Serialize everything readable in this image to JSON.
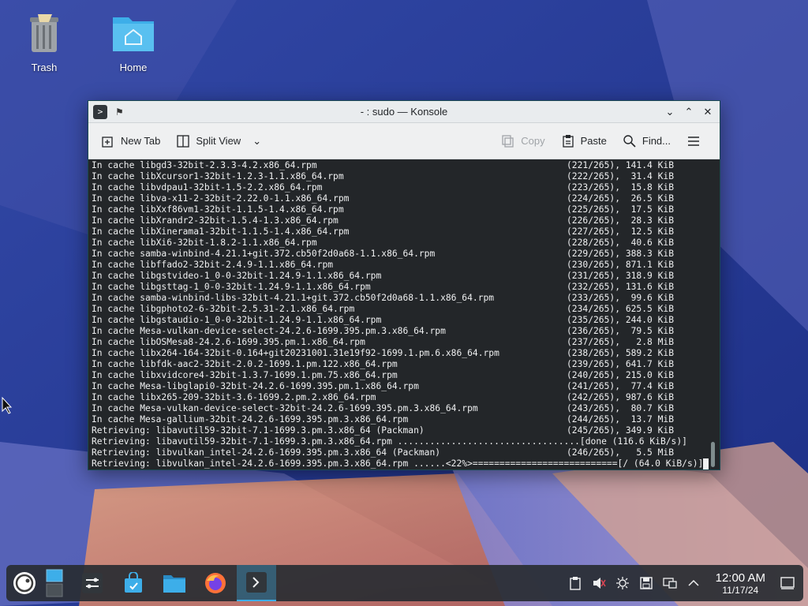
{
  "desktop": {
    "icons": [
      {
        "label": "Trash"
      },
      {
        "label": "Home"
      }
    ]
  },
  "window": {
    "title": "- : sudo — Konsole",
    "toolbar": {
      "new_tab": "New Tab",
      "split_view": "Split View",
      "copy": "Copy",
      "paste": "Paste",
      "find": "Find..."
    },
    "terminal_lines": [
      {
        "left": "In cache libgd3-32bit-2.3.3-4.2.x86_64.rpm",
        "right": "(221/265), 141.4 KiB"
      },
      {
        "left": "In cache libXcursor1-32bit-1.2.3-1.1.x86_64.rpm",
        "right": "(222/265),  31.4 KiB"
      },
      {
        "left": "In cache libvdpau1-32bit-1.5-2.2.x86_64.rpm",
        "right": "(223/265),  15.8 KiB"
      },
      {
        "left": "In cache libva-x11-2-32bit-2.22.0-1.1.x86_64.rpm",
        "right": "(224/265),  26.5 KiB"
      },
      {
        "left": "In cache libXxf86vm1-32bit-1.1.5-1.4.x86_64.rpm",
        "right": "(225/265),  17.5 KiB"
      },
      {
        "left": "In cache libXrandr2-32bit-1.5.4-1.3.x86_64.rpm",
        "right": "(226/265),  28.3 KiB"
      },
      {
        "left": "In cache libXinerama1-32bit-1.1.5-1.4.x86_64.rpm",
        "right": "(227/265),  12.5 KiB"
      },
      {
        "left": "In cache libXi6-32bit-1.8.2-1.1.x86_64.rpm",
        "right": "(228/265),  40.6 KiB"
      },
      {
        "left": "In cache samba-winbind-4.21.1+git.372.cb50f2d0a68-1.1.x86_64.rpm",
        "right": "(229/265), 388.3 KiB"
      },
      {
        "left": "In cache libffado2-32bit-2.4.9-1.1.x86_64.rpm",
        "right": "(230/265), 871.1 KiB"
      },
      {
        "left": "In cache libgstvideo-1_0-0-32bit-1.24.9-1.1.x86_64.rpm",
        "right": "(231/265), 318.9 KiB"
      },
      {
        "left": "In cache libgsttag-1_0-0-32bit-1.24.9-1.1.x86_64.rpm",
        "right": "(232/265), 131.6 KiB"
      },
      {
        "left": "In cache samba-winbind-libs-32bit-4.21.1+git.372.cb50f2d0a68-1.1.x86_64.rpm",
        "right": "(233/265),  99.6 KiB"
      },
      {
        "left": "In cache libgphoto2-6-32bit-2.5.31-2.1.x86_64.rpm",
        "right": "(234/265), 625.5 KiB"
      },
      {
        "left": "In cache libgstaudio-1_0-0-32bit-1.24.9-1.1.x86_64.rpm",
        "right": "(235/265), 244.0 KiB"
      },
      {
        "left": "In cache Mesa-vulkan-device-select-24.2.6-1699.395.pm.3.x86_64.rpm",
        "right": "(236/265),  79.5 KiB"
      },
      {
        "left": "In cache libOSMesa8-24.2.6-1699.395.pm.1.x86_64.rpm",
        "right": "(237/265),   2.8 MiB"
      },
      {
        "left": "In cache libx264-164-32bit-0.164+git20231001.31e19f92-1699.1.pm.6.x86_64.rpm",
        "right": "(238/265), 589.2 KiB"
      },
      {
        "left": "In cache libfdk-aac2-32bit-2.0.2-1699.1.pm.122.x86_64.rpm",
        "right": "(239/265), 641.7 KiB"
      },
      {
        "left": "In cache libxvidcore4-32bit-1.3.7-1699.1.pm.75.x86_64.rpm",
        "right": "(240/265), 215.0 KiB"
      },
      {
        "left": "In cache Mesa-libglapi0-32bit-24.2.6-1699.395.pm.1.x86_64.rpm",
        "right": "(241/265),  77.4 KiB"
      },
      {
        "left": "In cache libx265-209-32bit-3.6-1699.2.pm.2.x86_64.rpm",
        "right": "(242/265), 987.6 KiB"
      },
      {
        "left": "In cache Mesa-vulkan-device-select-32bit-24.2.6-1699.395.pm.3.x86_64.rpm",
        "right": "(243/265),  80.7 KiB"
      },
      {
        "left": "In cache Mesa-gallium-32bit-24.2.6-1699.395.pm.3.x86_64.rpm",
        "right": "(244/265),  13.7 MiB"
      },
      {
        "left": "Retrieving: libavutil59-32bit-7.1-1699.3.pm.3.x86_64 (Packman)",
        "right": "(245/265), 349.9 KiB"
      }
    ],
    "progress_line_1": "Retrieving: libavutil59-32bit-7.1-1699.3.pm.3.x86_64.rpm ..................................[done (116.6 KiB/s)]",
    "retrieving_line": {
      "left": "Retrieving: libvulkan_intel-24.2.6-1699.395.pm.3.x86_64 (Packman)",
      "right": "(246/265),   5.5 MiB"
    },
    "progress_line_2": "Retrieving: libvulkan_intel-24.2.6-1699.395.pm.3.x86_64.rpm ......<22%>===========================[/ (64.0 KiB/s)]"
  },
  "taskbar": {
    "clock_time": "12:00 AM",
    "clock_date": "11/17/24",
    "launchers": [
      {
        "name": "application-launcher"
      },
      {
        "name": "pager"
      },
      {
        "name": "system-settings"
      },
      {
        "name": "discover-store"
      },
      {
        "name": "dolphin-file-manager"
      },
      {
        "name": "firefox"
      },
      {
        "name": "konsole"
      }
    ]
  }
}
